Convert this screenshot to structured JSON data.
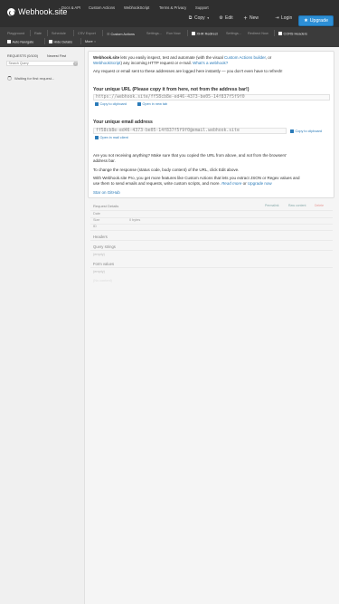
{
  "brand": {
    "name": "Webhook.site"
  },
  "nav": {
    "links": [
      "Docs & API",
      "Custom Actions",
      "WebhookScript",
      "Terms & Privacy",
      "Support"
    ],
    "copy": "Copy",
    "edit": "Edit",
    "new": "New",
    "login": "Login",
    "upgrade": "Upgrade"
  },
  "toolbar": {
    "row1": [
      "Playground",
      "Rate",
      "Schedule",
      "CSV Export"
    ],
    "custom_actions": "Custom Actions",
    "settings": "Settings...",
    "run_now": "Run Now",
    "xhr_redirect": "XHR Redirect",
    "xhr_settings": "Settings...",
    "redirect_now": "Redirect Now",
    "cors": "CORS Headers",
    "auto_navigate": "Auto Navigate",
    "hide_details": "Hide Details",
    "more": "More"
  },
  "sidebar": {
    "requests_label": "REQUESTS (0/100)",
    "newest_first": "Newest First",
    "search_placeholder": "Search Query",
    "waiting": "Waiting for first request..."
  },
  "main": {
    "intro_a": "Webhook.site",
    "intro_b": " lets you easily inspect, test and automate (with the visual ",
    "intro_link1": "Custom Actions builder",
    "intro_c": ", or",
    "intro_link2": "WebhookScript",
    "intro_d": ") any incoming HTTP request or e-mail. ",
    "intro_link3": "What's a webhook?",
    "any_request": "Any request or email sent to these addresses are logged here instantly — you don't even have to refresh!",
    "url_heading": "Your unique URL (Please copy it from here, not from the address bar!)",
    "url_value": "https://webhook.site/ff58cb8e-ed46-4373-be05-14f837f5f9f0",
    "copy_clipboard": "Copy to clipboard",
    "open_new_tab": "Open in new tab",
    "email_heading": "Your unique email address",
    "email_value": "ff58cb8e-ed46-4373-be05-14f837f5f9f0@email.webhook.site",
    "copy_clipboard2": "Copy to clipboard",
    "open_mail": "Open in mail client",
    "not_receiving_1": "Are you not receiving anything? Make sure that you copied the URL from above, and ",
    "not_receiving_em": "not",
    "not_receiving_2": " from the browsers'",
    "not_receiving_3": "address bar.",
    "change_response": "To change the response (status code, body content) of the URL, click Edit above.",
    "pro_1": "With Webhook.site Pro, you get more features like Custom Actions that lets you extract JSON or Regex values and",
    "pro_2": "use them to send emails and requests, write custom scripts, and more. ",
    "read_more": "Read more",
    "or": " or ",
    "upgrade_now": "Upgrade now",
    "star": "Star on GitHub"
  },
  "details": {
    "title": "Request Details",
    "permalink": "Permalink",
    "raw_content": "Raw content",
    "delete": "Delete",
    "date_label": "Date",
    "size_label": "Size",
    "size_value": "0 bytes",
    "id_label": "ID",
    "headers": "Headers",
    "query_strings": "Query strings",
    "query_empty": "(empty)",
    "form_values": "Form values",
    "form_empty": "(empty)",
    "no_content": "(No content)"
  },
  "colors": {
    "navbar": "#2f2f2f",
    "toolbar": "#3b3b3b",
    "accent": "#2d8fd6",
    "link": "#2a7ab8",
    "delete": "#d9534f"
  }
}
